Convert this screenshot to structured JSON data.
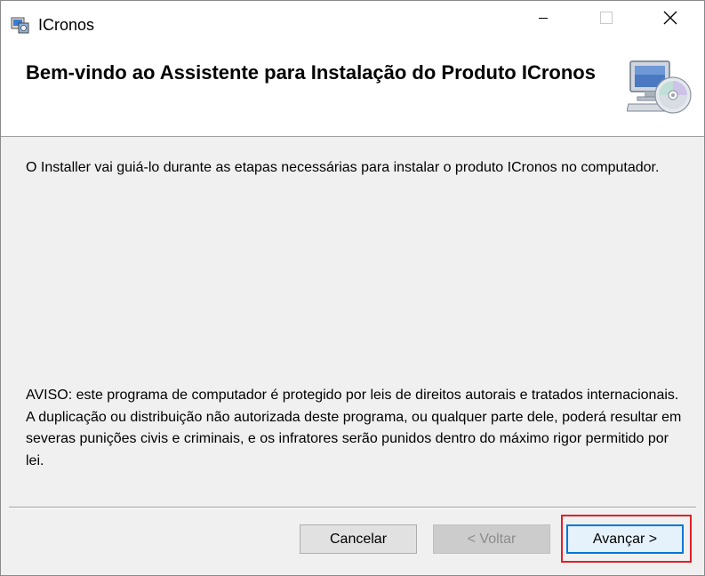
{
  "window": {
    "title": "ICronos",
    "controls": {
      "minimize": "minimize-icon",
      "maximize": "maximize-icon",
      "close": "close-icon"
    }
  },
  "banner": {
    "title": "Bem-vindo ao Assistente para Instalação do Produto ICronos",
    "icon": "computer-cd-icon"
  },
  "body": {
    "intro": "O Installer vai guiá-lo durante as etapas necessárias para instalar o produto ICronos no computador.",
    "warning": "AVISO: este programa de computador é protegido por leis de direitos autorais e tratados internacionais. A duplicação ou distribuição não autorizada deste programa, ou qualquer parte dele, poderá resultar em severas punições civis e criminais, e os infratores serão punidos dentro do máximo rigor permitido por lei."
  },
  "buttons": {
    "cancel": "Cancelar",
    "back": "< Voltar",
    "next": "Avançar >"
  },
  "colors": {
    "highlight": "#e0202a",
    "focus_border": "#0078d7",
    "dialog_bg": "#f0f0f0"
  },
  "state": {
    "back_enabled": false,
    "highlighted_button": "next"
  }
}
